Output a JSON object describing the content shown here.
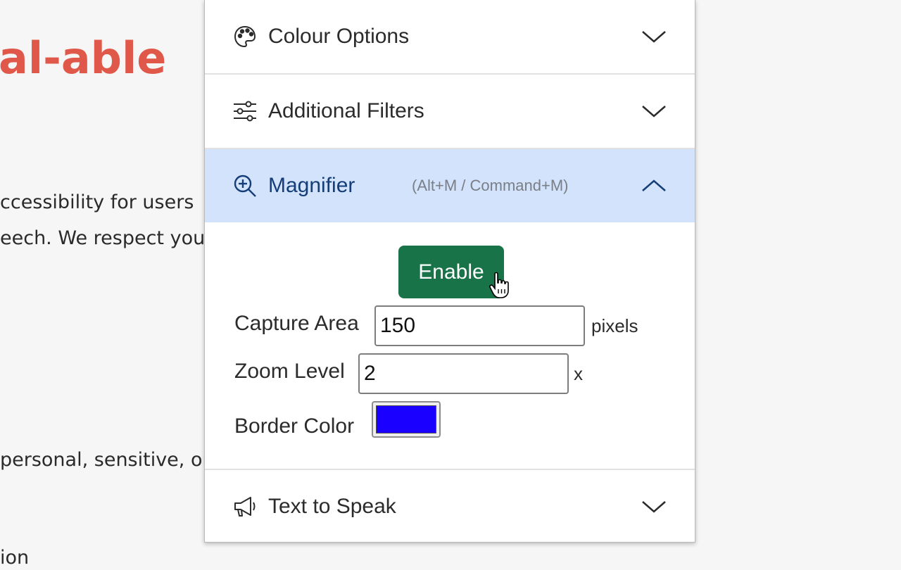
{
  "background_page": {
    "heading": "al-able",
    "lines": [
      "ccessibility for users",
      "eech. We respect you",
      "personal, sensitive, or",
      "ion"
    ]
  },
  "panel": {
    "sections": [
      {
        "label": "Colour Options",
        "icon": "palette-icon",
        "expanded": false
      },
      {
        "label": "Additional Filters",
        "icon": "sliders-icon",
        "expanded": false
      },
      {
        "label": "Magnifier",
        "shortcut": "(Alt+M / Command+M)",
        "icon": "zoom-in-icon",
        "expanded": true
      },
      {
        "label": "Text to Speak",
        "icon": "megaphone-icon",
        "expanded": false
      }
    ],
    "magnifier": {
      "enable_label": "Enable",
      "capture_area_label": "Capture Area",
      "capture_area_value": "150",
      "capture_area_unit": "pixels",
      "zoom_level_label": "Zoom Level",
      "zoom_level_value": "2",
      "zoom_level_unit": "x",
      "border_color_label": "Border Color",
      "border_color_value": "#1a00ff"
    }
  },
  "colors": {
    "accent_green": "#187448",
    "active_header_bg": "#d2e3fb",
    "heading_red": "#e0584a"
  }
}
